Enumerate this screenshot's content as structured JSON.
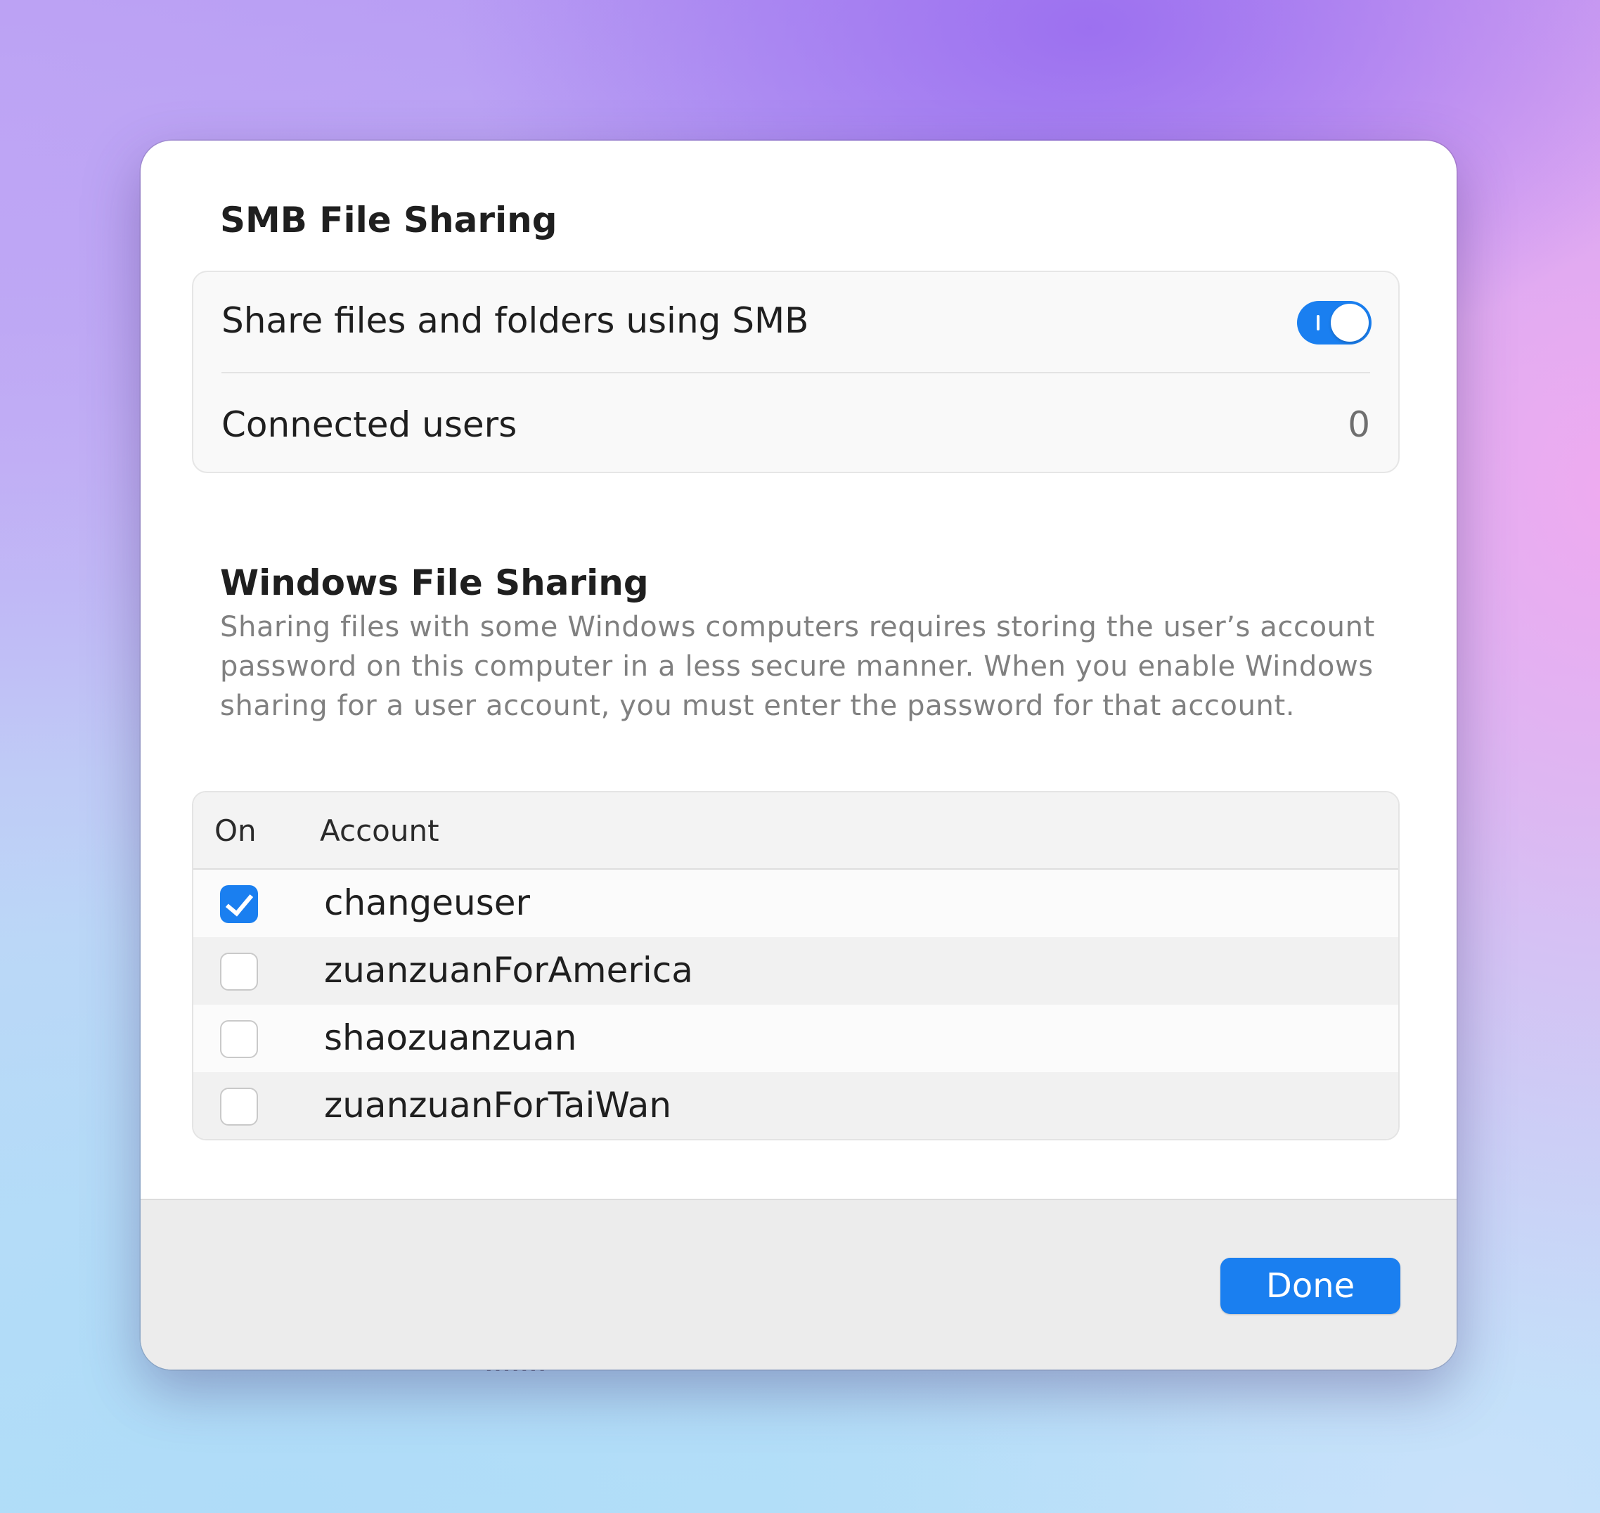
{
  "dialog": {
    "smb_section": {
      "title": "SMB File Sharing",
      "share_label": "Share files and folders using SMB",
      "share_enabled": true,
      "connected_users_label": "Connected users",
      "connected_users_count": "0"
    },
    "windows_section": {
      "title": "Windows File Sharing",
      "description": "Sharing files with some Windows computers requires storing the user’s account password on this computer in a less secure manner. When you enable Windows sharing for a user account, you must enter the password for that account.",
      "table": {
        "columns": [
          "On",
          "Account"
        ],
        "rows": [
          {
            "account": "changeuser",
            "checked": true
          },
          {
            "account": "zuanzuanForAmerica",
            "checked": false
          },
          {
            "account": "shaozuanzuan",
            "checked": false
          },
          {
            "account": "zuanzuanForTaiWan",
            "checked": false
          }
        ]
      }
    },
    "footer": {
      "done_label": "Done"
    }
  },
  "colors": {
    "accent": "#1a7ff0",
    "text_primary": "#1f1f1f",
    "text_secondary": "#808080"
  },
  "icons": {
    "toggle": "toggle-switch-on",
    "checked": "checkmark-icon"
  }
}
